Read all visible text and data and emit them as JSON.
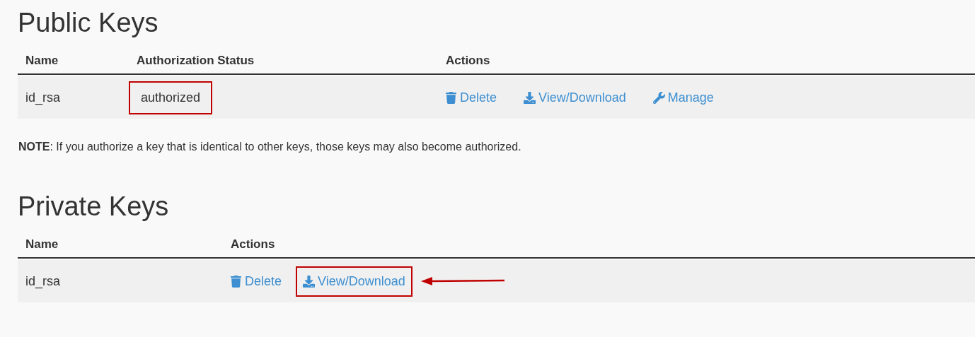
{
  "public_keys": {
    "title": "Public Keys",
    "columns": [
      "Name",
      "Authorization Status",
      "Actions"
    ],
    "rows": [
      {
        "name": "id_rsa",
        "status": "authorized",
        "status_highlighted": true,
        "actions": [
          {
            "kind": "delete",
            "label": "Delete",
            "highlighted": false
          },
          {
            "kind": "download",
            "label": "View/Download",
            "highlighted": false
          },
          {
            "kind": "manage",
            "label": "Manage",
            "highlighted": false
          }
        ]
      }
    ],
    "note": "**NOTE**: If you authorize a key that is identical to other keys, those keys may also become authorized."
  },
  "private_keys": {
    "title": "Private Keys",
    "columns": [
      "Name",
      "Actions"
    ],
    "rows": [
      {
        "name": "id_rsa",
        "actions": [
          {
            "kind": "delete",
            "label": "Delete",
            "highlighted": false
          },
          {
            "kind": "download",
            "label": "View/Download",
            "highlighted": true
          }
        ]
      }
    ]
  }
}
